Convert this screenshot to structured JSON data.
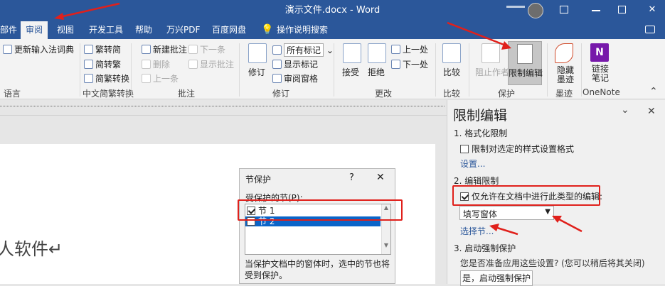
{
  "window": {
    "title": "演示文件.docx  -  Word"
  },
  "tabs": [
    {
      "label": "部件"
    },
    {
      "label": "审阅"
    },
    {
      "label": "视图"
    },
    {
      "label": "开发工具"
    },
    {
      "label": "帮助"
    },
    {
      "label": "万兴PDF"
    },
    {
      "label": "百度网盘"
    },
    {
      "label": "操作说明搜索"
    }
  ],
  "ribbon": {
    "language": {
      "update_ime": "更新输入法词典",
      "group": "语言"
    },
    "chinese": {
      "to_trad": "繁转简",
      "to_simp": "简转繁",
      "convert": "简繁转换",
      "group": "中文简繁转换"
    },
    "comments": {
      "new": "新建批注",
      "delete": "删除",
      "prev": "上一条",
      "next": "下一条",
      "show": "显示批注",
      "group": "批注"
    },
    "tracking": {
      "revise": "修订",
      "markup": "所有标记",
      "show_markup": "显示标记",
      "review_pane": "审阅窗格",
      "group": "修订"
    },
    "changes": {
      "accept": "接受",
      "reject": "拒绝",
      "prev": "上一处",
      "next": "下一处",
      "group": "更改"
    },
    "compare": {
      "label": "比较",
      "group": "比较"
    },
    "protect": {
      "block_authors": "阻止作者",
      "restrict": "限制编辑",
      "group": "保护"
    },
    "ink": {
      "hide_ink": "隐藏墨迹",
      "group": "墨迹"
    },
    "onenote": {
      "linked_notes": "链接笔记",
      "group": "OneNote"
    }
  },
  "document": {
    "text": "人软件↵"
  },
  "panel": {
    "title": "限制编辑",
    "s1": "1. 格式化限制",
    "s1_check": "限制对选定的样式设置格式",
    "s1_settings": "设置...",
    "s2": "2. 编辑限制",
    "s2_check": "仅允许在文档中进行此类型的编辑:",
    "s2_select": "填写窗体",
    "s2_sections": "选择节...",
    "s3": "3. 启动强制保护",
    "s3_question": "您是否准备应用这些设置? (您可以稍后将其关闭)",
    "s3_button": "是，启动强制保护"
  },
  "dialog": {
    "title": "节保护",
    "help": "?",
    "list_label": "受保护的节(P):",
    "sections": [
      "节 1",
      "节 2"
    ],
    "note": "当保护文档中的窗体时，选中的节也将受到保护。"
  },
  "colors": {
    "word_blue": "#2b579a",
    "annotation_red": "#e0201b",
    "selection_blue": "#0a64c8"
  }
}
